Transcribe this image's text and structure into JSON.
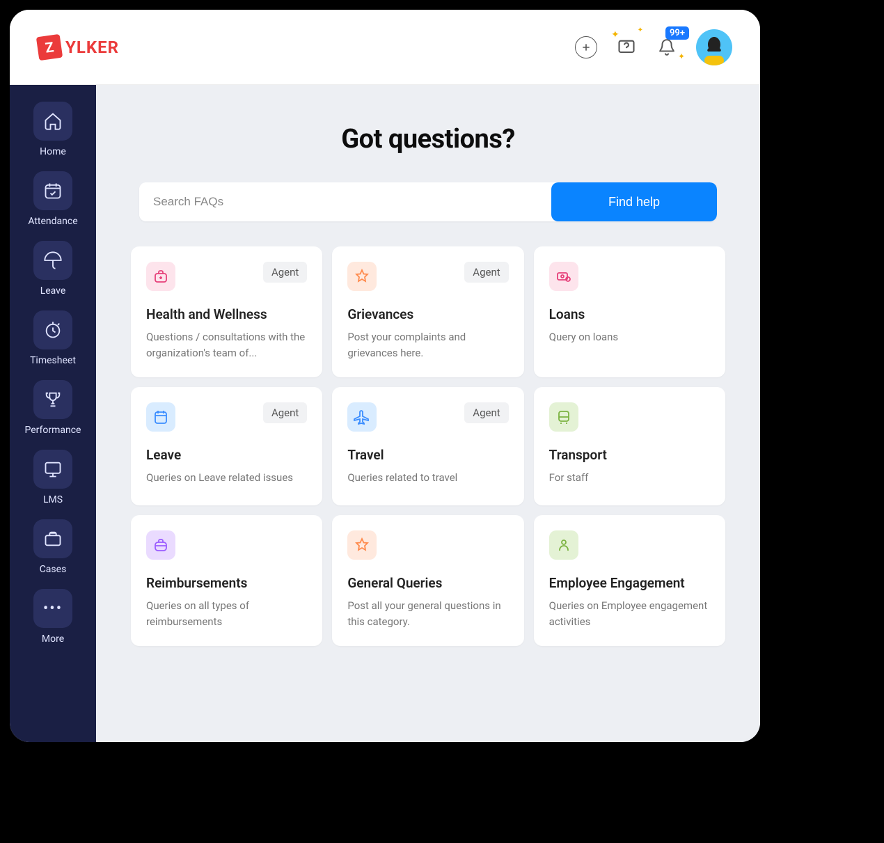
{
  "brand": {
    "logo_letter": "Z",
    "logo_text": "YLKER"
  },
  "topbar": {
    "notification_badge": "99+"
  },
  "sidebar": {
    "items": [
      {
        "label": "Home"
      },
      {
        "label": "Attendance"
      },
      {
        "label": "Leave"
      },
      {
        "label": "Timesheet"
      },
      {
        "label": "Performance"
      },
      {
        "label": "LMS"
      },
      {
        "label": "Cases"
      },
      {
        "label": "More"
      }
    ]
  },
  "page": {
    "title": "Got questions?",
    "search_placeholder": "Search FAQs",
    "find_button": "Find help"
  },
  "cards": [
    {
      "title": "Health and Wellness",
      "desc": "Questions / consultations with the organization's team of...",
      "tag": "Agent",
      "icon_bg": "#fde4ec",
      "icon_color": "#e6407a"
    },
    {
      "title": "Grievances",
      "desc": "Post your complaints and grievances here.",
      "tag": "Agent",
      "icon_bg": "#ffe9de",
      "icon_color": "#ff8a4c"
    },
    {
      "title": "Loans",
      "desc": "Query on loans",
      "tag": "",
      "icon_bg": "#fde4ec",
      "icon_color": "#e6407a"
    },
    {
      "title": "Leave",
      "desc": "Queries on Leave related issues",
      "tag": "Agent",
      "icon_bg": "#d9ecff",
      "icon_color": "#3a8dff"
    },
    {
      "title": "Travel",
      "desc": "Queries related to travel",
      "tag": "Agent",
      "icon_bg": "#d9ecff",
      "icon_color": "#3a8dff"
    },
    {
      "title": "Transport",
      "desc": "For staff",
      "tag": "",
      "icon_bg": "#e4f2d5",
      "icon_color": "#7cb342"
    },
    {
      "title": "Reimbursements",
      "desc": "Queries on all types of reimbursements",
      "tag": "",
      "icon_bg": "#eadbff",
      "icon_color": "#9b5cff"
    },
    {
      "title": "General Queries",
      "desc": "Post all your general questions in this category.",
      "tag": "",
      "icon_bg": "#ffe9de",
      "icon_color": "#ff8a4c"
    },
    {
      "title": "Employee Engagement",
      "desc": "Queries on Employee engagement activities",
      "tag": "",
      "icon_bg": "#e4f2d5",
      "icon_color": "#7cb342"
    }
  ]
}
